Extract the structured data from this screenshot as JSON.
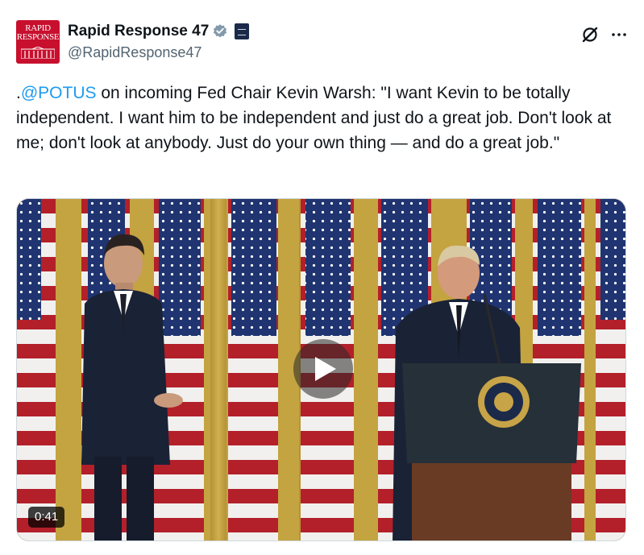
{
  "author": {
    "display_name": "Rapid Response 47",
    "handle": "@RapidResponse47",
    "avatar_text": "RAPID RESPONSE",
    "verified": true
  },
  "tweet": {
    "text_prefix": ".",
    "mention": "@POTUS",
    "text_body": " on incoming Fed Chair Kevin Warsh: \"I want Kevin to be totally independent. I want him to be independent and just do a great job. Don't look at me; don't look at anybody. Just do your own thing — and do a great job.\""
  },
  "media": {
    "type": "video",
    "duration": "0:41",
    "seal_text": "PRESIDENT OF THE UNITED STATES"
  },
  "icons": {
    "grok": "grok-icon",
    "more": "more-dots-icon",
    "play": "play-icon",
    "verified": "verified-badge-icon"
  },
  "colors": {
    "link": "#1d9bf0",
    "verified_badge": "#829aab",
    "avatar_bg": "#c8102e",
    "text": "#0f1419",
    "secondary_text": "#536471"
  }
}
